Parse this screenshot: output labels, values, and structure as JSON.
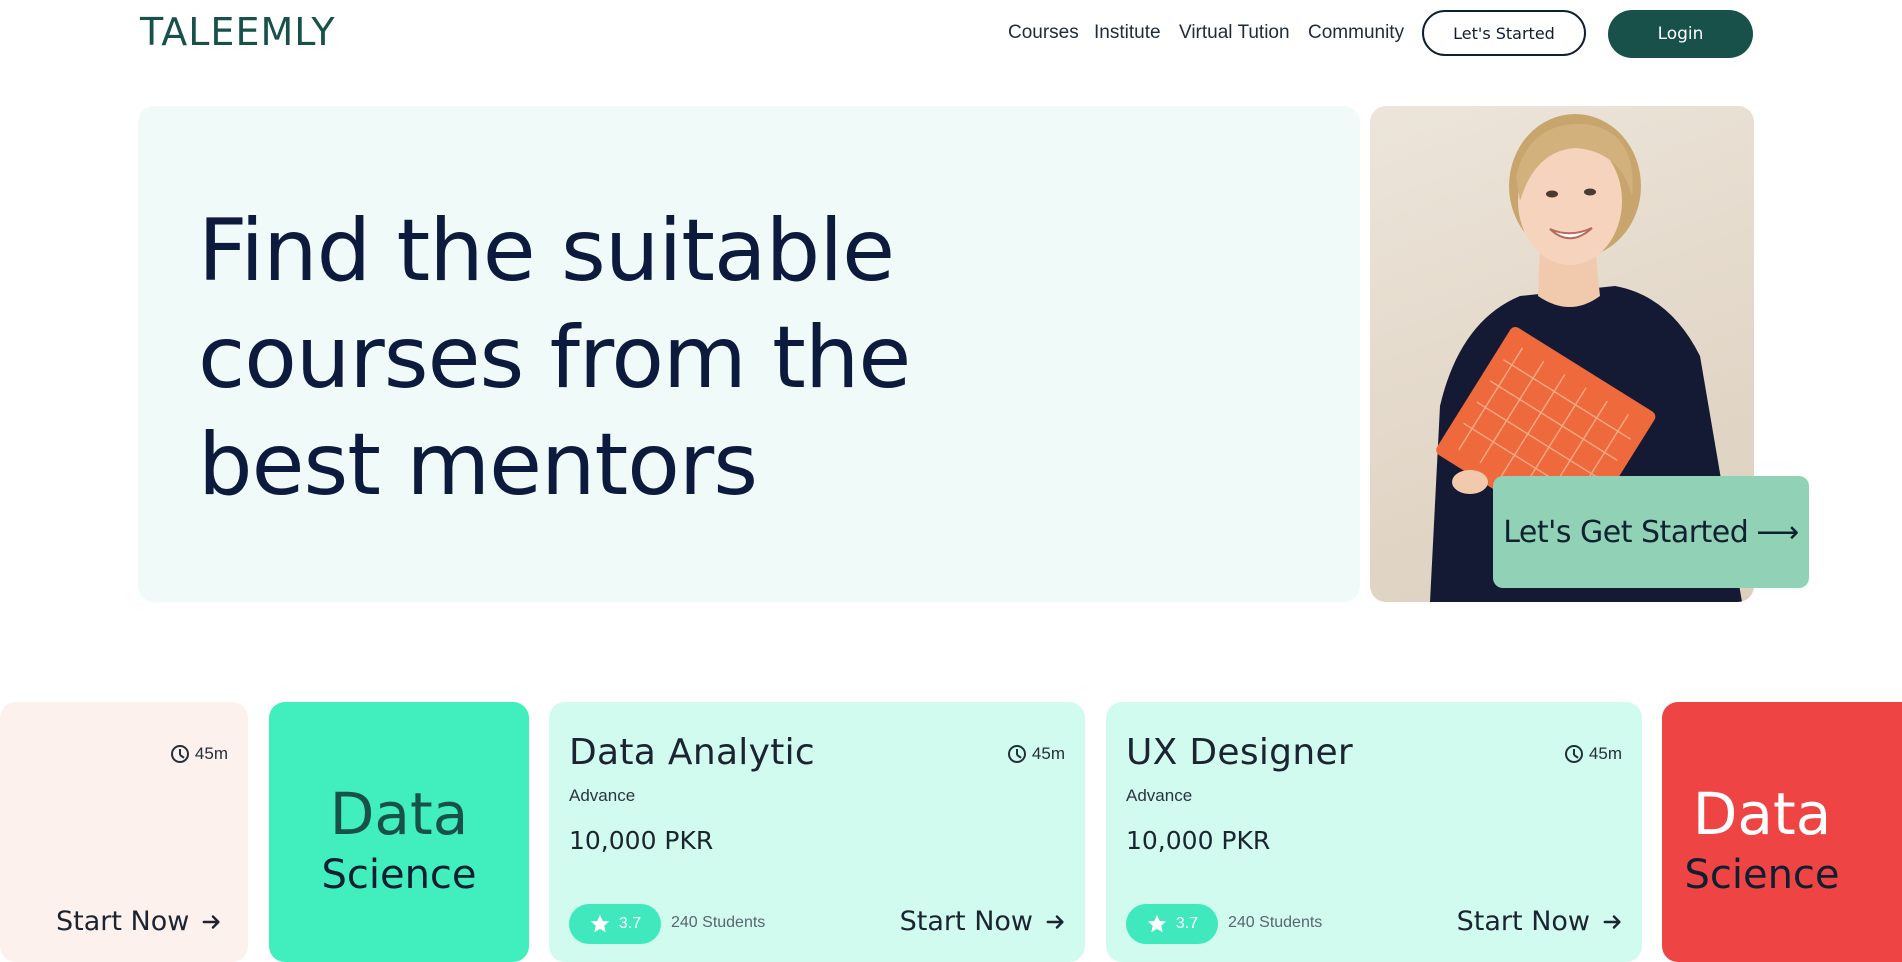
{
  "brand": {
    "logo": "TALEEMLY",
    "logo_color": "#17514a"
  },
  "nav": {
    "items": [
      "Courses",
      "Institute",
      "Virtual Tution",
      "Community"
    ],
    "cta_outline": "Let's Started",
    "login": "Login"
  },
  "hero": {
    "title_line1": "Find the suitable",
    "title_line2": "courses from the",
    "title_line3": "best mentors",
    "cta_label": "Let's Get Started",
    "cta_arrow": "⟶",
    "background_color": "#f0fbf9",
    "cta_color": "#91d2b6"
  },
  "cards": {
    "partial_left": {
      "duration": "45m",
      "start_label": "Start Now"
    },
    "promo_teal": {
      "word1": "Data",
      "word2": "Science",
      "color": "#40eebe"
    },
    "data_analytic": {
      "title": "Data Analytic",
      "duration": "45m",
      "level": "Advance",
      "price": "10,000 PKR",
      "rating": "3.7",
      "students": "240 Students",
      "start_label": "Start Now"
    },
    "ux_designer": {
      "title": "UX Designer",
      "duration": "45m",
      "level": "Advance",
      "price": "10,000 PKR",
      "rating": "3.7",
      "students": "240 Students",
      "start_label": "Start Now"
    },
    "promo_red": {
      "word1": "Data",
      "word2": "Science",
      "color": "#ef4444"
    }
  }
}
